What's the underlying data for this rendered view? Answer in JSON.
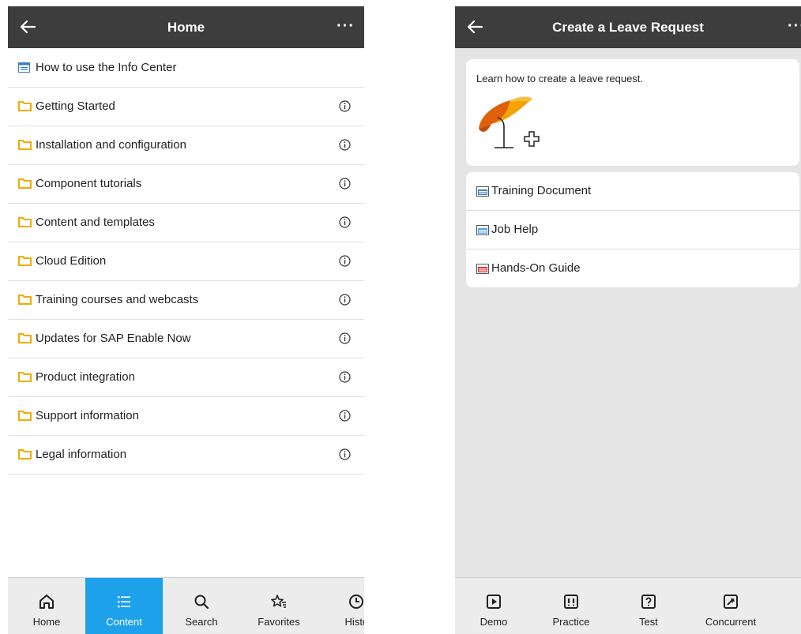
{
  "left": {
    "header": {
      "title": "Home",
      "more": "···"
    },
    "items": [
      {
        "label": "How to use the Info Center",
        "icon": "page-icon",
        "info": false
      },
      {
        "label": "Getting Started",
        "icon": "folder-icon",
        "info": true
      },
      {
        "label": "Installation and configuration",
        "icon": "folder-icon",
        "info": true
      },
      {
        "label": "Component tutorials",
        "icon": "folder-icon",
        "info": true
      },
      {
        "label": "Content and templates",
        "icon": "folder-icon",
        "info": true
      },
      {
        "label": "Cloud Edition",
        "icon": "folder-icon",
        "info": true
      },
      {
        "label": "Training courses and webcasts",
        "icon": "folder-icon",
        "info": true
      },
      {
        "label": "Updates for SAP Enable Now",
        "icon": "folder-icon",
        "info": true
      },
      {
        "label": "Product integration",
        "icon": "folder-icon",
        "info": true
      },
      {
        "label": "Support information",
        "icon": "folder-icon",
        "info": true
      },
      {
        "label": "Legal information",
        "icon": "folder-icon",
        "info": true
      }
    ],
    "nav": [
      {
        "label": "Home",
        "icon": "home-icon",
        "active": false
      },
      {
        "label": "Content",
        "icon": "list-icon",
        "active": true
      },
      {
        "label": "Search",
        "icon": "search-icon",
        "active": false
      },
      {
        "label": "Favorites",
        "icon": "favorites-star-icon",
        "active": false
      },
      {
        "label": "Histc",
        "icon": "history-clock-icon",
        "active": false
      }
    ]
  },
  "right": {
    "header": {
      "title": "Create a Leave Request",
      "more": "···"
    },
    "description": "Learn how to create a leave request.",
    "documents": [
      {
        "label": "Training Document",
        "icon": "doc-file-icon"
      },
      {
        "label": "Job Help",
        "icon": "htm-file-icon"
      },
      {
        "label": "Hands-On Guide",
        "icon": "pdf-file-icon"
      }
    ],
    "nav": [
      {
        "label": "Demo",
        "icon": "demo-play-icon"
      },
      {
        "label": "Practice",
        "icon": "practice-icon"
      },
      {
        "label": "Test",
        "icon": "test-question-icon"
      },
      {
        "label": "Concurrent",
        "icon": "concurrent-icon"
      }
    ]
  },
  "colors": {
    "header": "#3d3d3d",
    "accent": "#1ea1eb",
    "folder": "#f0ab00",
    "background_right": "#e5e5e5"
  }
}
